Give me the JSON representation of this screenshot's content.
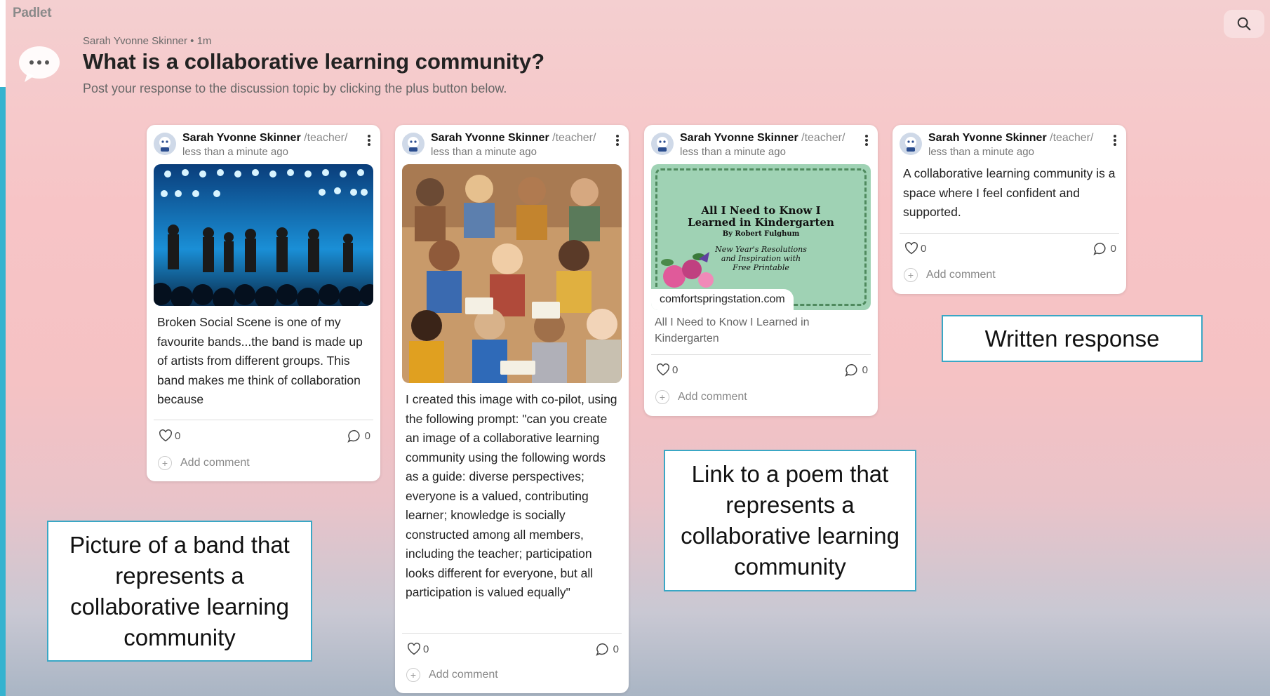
{
  "app": {
    "logo": "Padlet"
  },
  "topic": {
    "meta": "Sarah Yvonne Skinner • 1m",
    "title": "What is a collaborative learning community?",
    "subtitle": "Post your response to the discussion topic by clicking the plus button below."
  },
  "icons": [
    "search-icon",
    "speech-bubble-icon",
    "heart-icon",
    "comment-icon",
    "plus-icon",
    "kebab-icon"
  ],
  "posts": [
    {
      "author": "Sarah Yvonne Skinner",
      "role": "/teacher/",
      "time": "less than a minute ago",
      "text": "Broken Social Scene is one of my favourite bands...the band is made up of artists from different groups. This band makes me think of collaboration because",
      "likes": "0",
      "comments": "0",
      "add_comment": "Add comment"
    },
    {
      "author": "Sarah Yvonne Skinner",
      "role": "/teacher/",
      "time": "less than a minute ago",
      "text": "I created this image with co-pilot, using the following prompt: \"can you create an image of a collaborative learning community using the following words as a guide: diverse perspectives; everyone is a valued, contributing learner; knowledge is socially constructed among all members, including the teacher; participation looks different for everyone, but all participation is valued equally\"",
      "likes": "0",
      "comments": "0",
      "add_comment": "Add comment"
    },
    {
      "author": "Sarah Yvonne Skinner",
      "role": "/teacher/",
      "time": "less than a minute ago",
      "preview": {
        "line1": "All I Need to Know I",
        "line2": "Learned in Kindergarten",
        "byline": "By Robert Fulghum",
        "sub1": "New Year's Resolutions",
        "sub2": "and Inspiration with",
        "sub3": "Free Printable"
      },
      "domain": "comfortspringstation.com",
      "link_title": "All I Need to Know I Learned in Kindergarten",
      "likes": "0",
      "comments": "0",
      "add_comment": "Add comment"
    },
    {
      "author": "Sarah Yvonne Skinner",
      "role": "/teacher/",
      "time": "less than a minute ago",
      "text": "A collaborative learning community is a space where I feel confident and supported.",
      "likes": "0",
      "comments": "0",
      "add_comment": "Add comment"
    }
  ],
  "callouts": {
    "band": "Picture of a band that represents a collaborative learning community",
    "poem": "Link to a poem that represents a collaborative learning community",
    "written": "Written response"
  }
}
